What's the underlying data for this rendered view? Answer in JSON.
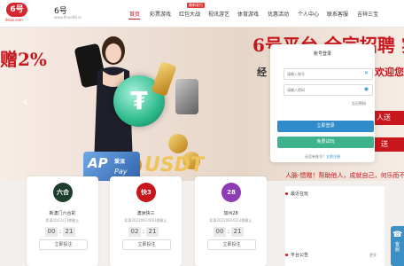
{
  "header": {
    "logo_text": "6号",
    "logo_domain": "6hao.com",
    "site_name": "6号",
    "site_url": "www.6hao66.cc",
    "nav": [
      "首页",
      "彩票游戏",
      "红包大战",
      "视讯游艺",
      "体育游戏",
      "优惠活动",
      "个人中心",
      "联系客服",
      "吉祥三宝"
    ],
    "hot_badge": "最新发行"
  },
  "banner": {
    "promo_left": "赠2%",
    "promo_right": "6号平台 全宗招聘 实",
    "side_text_1": "经",
    "side_text_2": "欢迎您一",
    "tag_1": "人送",
    "tag_2": "送",
    "ap_logo": "AP",
    "ap_name": "爱派",
    "ap_pay": "Pay",
    "usdt": "USDT",
    "coin_symbol": "₮"
  },
  "login": {
    "title": "账号登录",
    "username_placeholder": "请输入账号",
    "password_placeholder": "请输入密码",
    "forgot": "忘记密码",
    "login_button": "立即登录",
    "trial_button": "免费试玩",
    "register_prompt": "还没有账号？",
    "register_link": "立即注册"
  },
  "lottery_cards": [
    {
      "name": "新澳门六合彩",
      "countdown": "距离2022173期截止",
      "icon_label": "六合",
      "icon_color": "#1d3d2d",
      "timer": [
        "00",
        "21"
      ],
      "button": "立即投注"
    },
    {
      "name": "澳洲快三",
      "countdown": "距离20220614691期截止",
      "icon_label": "快3",
      "icon_color": "#c8161d",
      "timer": [
        "02",
        "21"
      ],
      "button": "立即投注"
    },
    {
      "name": "加州28",
      "countdown": "距离20220624313期截止",
      "icon_label": "28",
      "icon_color": "#8e3bb5",
      "timer": [
        "00",
        "21"
      ],
      "button": "立即投注"
    }
  ],
  "motto": "人脉-馈赠！帮助他人，成就自己，何乐而不",
  "info": {
    "recent_title": "最近在玩",
    "notice_title": "平台公告",
    "more": "更多"
  },
  "sidebar": {
    "cs_icon": "chat-icon",
    "cs_label": "客服"
  },
  "colors": {
    "brand_red": "#c8161d",
    "login_blue": "#2f8bc9",
    "trial_green": "#3cb38c"
  }
}
